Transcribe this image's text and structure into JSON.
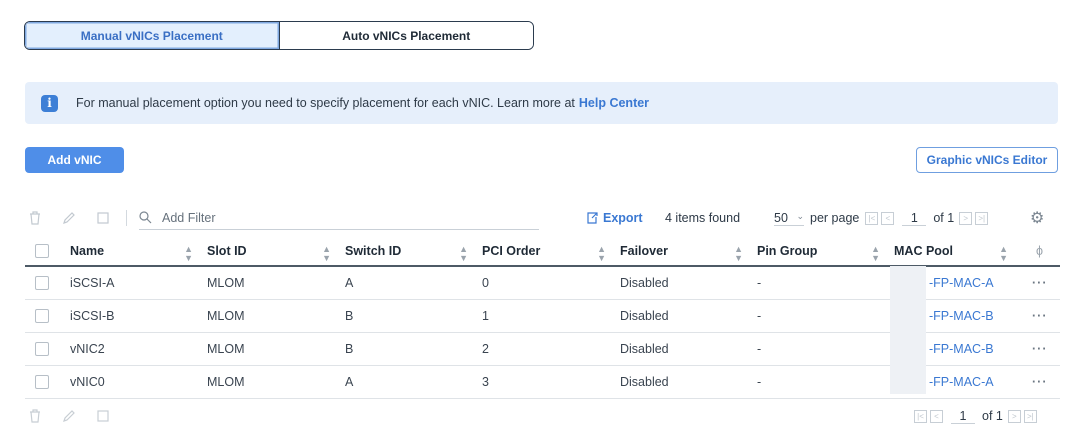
{
  "placement_tabs": [
    {
      "label": "Manual vNICs Placement",
      "active": true
    },
    {
      "label": "Auto vNICs Placement",
      "active": false
    }
  ],
  "banner": {
    "text": "For manual placement option you need to specify placement for each vNIC. Learn more at",
    "link": "Help Center"
  },
  "buttons": {
    "add": "Add vNIC",
    "graphic_editor": "Graphic vNICs Editor"
  },
  "toolbar": {
    "filter_placeholder": "Add Filter",
    "export": "Export",
    "items_found": "4 items found",
    "per_page_value": "50",
    "per_page_label": "per page",
    "page": "1",
    "of_pages": "of 1"
  },
  "table": {
    "columns": [
      "Name",
      "Slot ID",
      "Switch ID",
      "PCI Order",
      "Failover",
      "Pin Group",
      "MAC Pool"
    ],
    "rows": [
      {
        "name": "iSCSI-A",
        "slot": "MLOM",
        "switch": "A",
        "pci": "0",
        "failover": "Disabled",
        "pin": "-",
        "mac": "-FP-MAC-A"
      },
      {
        "name": "iSCSI-B",
        "slot": "MLOM",
        "switch": "B",
        "pci": "1",
        "failover": "Disabled",
        "pin": "-",
        "mac": "-FP-MAC-B"
      },
      {
        "name": "vNIC2",
        "slot": "MLOM",
        "switch": "B",
        "pci": "2",
        "failover": "Disabled",
        "pin": "-",
        "mac": "-FP-MAC-B"
      },
      {
        "name": "vNIC0",
        "slot": "MLOM",
        "switch": "A",
        "pci": "3",
        "failover": "Disabled",
        "pin": "-",
        "mac": "-FP-MAC-A"
      }
    ],
    "row_actions": "···"
  },
  "footer": {
    "page": "1",
    "of_pages": "of 1"
  },
  "colors": {
    "accent": "#4f8ee8",
    "banner_bg": "#e6effb",
    "link": "#3a78d2"
  }
}
